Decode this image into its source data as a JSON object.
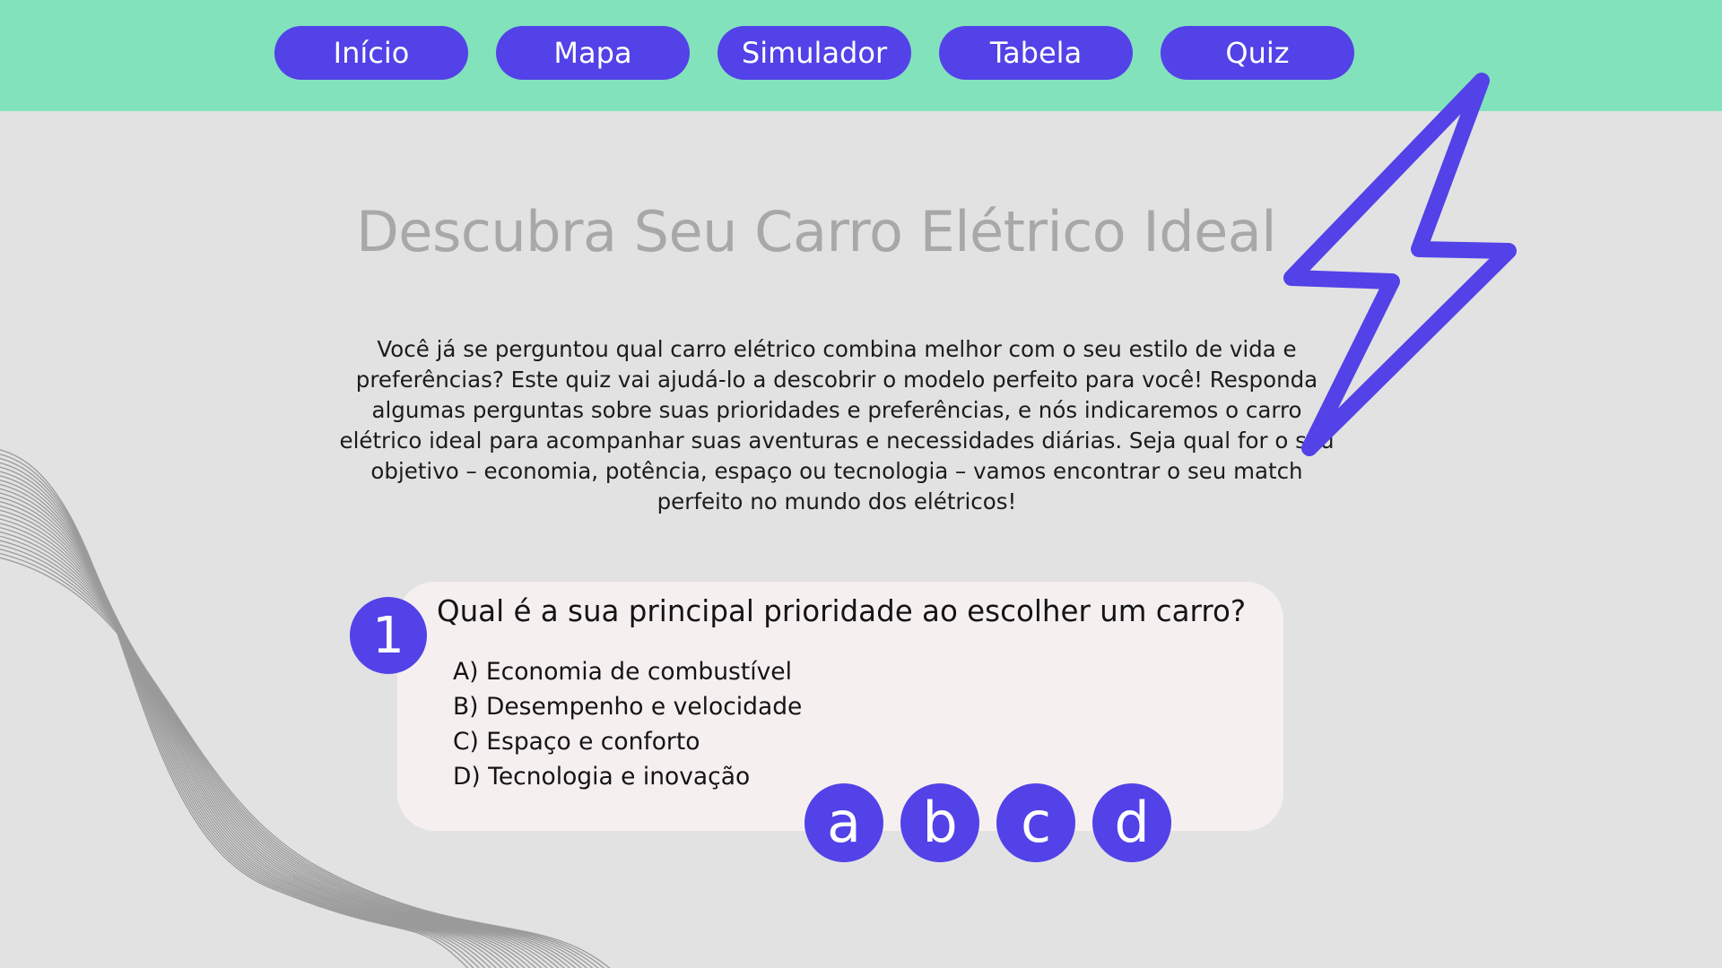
{
  "nav": {
    "items": [
      {
        "label": "Início"
      },
      {
        "label": "Mapa"
      },
      {
        "label": "Simulador"
      },
      {
        "label": "Tabela"
      },
      {
        "label": "Quiz"
      }
    ]
  },
  "hero": {
    "title": "Descubra Seu Carro Elétrico Ideal",
    "intro": "Você já se perguntou qual carro elétrico combina melhor com o seu estilo de vida e preferências? Este quiz vai ajudá-lo a descobrir o modelo perfeito para você! Responda algumas perguntas sobre suas prioridades e preferências, e nós indicaremos o carro elétrico ideal para acompanhar suas aventuras e necessidades diárias. Seja qual for o seu objetivo – economia, potência, espaço ou tecnologia – vamos encontrar o seu match perfeito no mundo dos elétricos!"
  },
  "quiz": {
    "number": "1",
    "question": "Qual é a sua principal prioridade ao escolher um carro?",
    "options": [
      "A) Economia de combustível",
      "B) Desempenho e velocidade",
      "C) Espaço e conforto",
      "D) Tecnologia e inovação"
    ],
    "answers": [
      "a",
      "b",
      "c",
      "d"
    ]
  },
  "colors": {
    "accent": "#5242e8",
    "topbar": "#82e2bc",
    "background": "#e2e2e2",
    "card": "#f6eff0",
    "title": "#a8a8a8"
  },
  "icons": {
    "decoration": "lightning-bolt-icon",
    "background": "wave-lines"
  }
}
